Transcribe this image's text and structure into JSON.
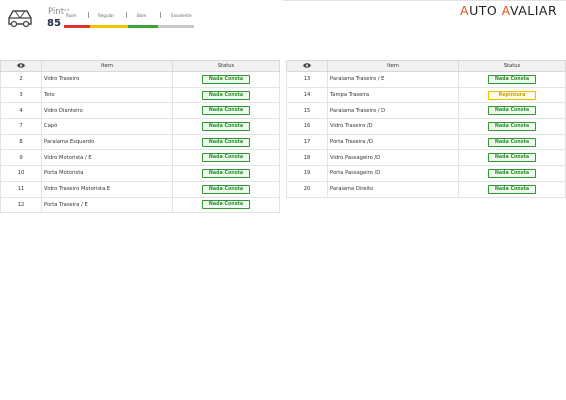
{
  "header": {
    "score_title": "Pintu",
    "score_value": "85",
    "gauge_labels": [
      "Ruim",
      "Regular",
      "Bom",
      "Excelente"
    ],
    "gauge_colors": [
      "#e03131",
      "#f2c200",
      "#3aa63a"
    ],
    "logo_part1": "AUTO",
    "logo_part2": "AVALIAR",
    "logo_accent": "#e2541d"
  },
  "table": {
    "col_item": "Item",
    "col_status": "Status"
  },
  "left_rows": [
    {
      "num": "2",
      "item": "Vidro Traseiro",
      "status": "Nada Consta",
      "type": "ok"
    },
    {
      "num": "3",
      "item": "Teto",
      "status": "Nada Consta",
      "type": "ok"
    },
    {
      "num": "4",
      "item": "Vidro Dianteiro",
      "status": "Nada Consta",
      "type": "ok"
    },
    {
      "num": "7",
      "item": "Capô",
      "status": "Nada Consta",
      "type": "ok"
    },
    {
      "num": "8",
      "item": "Paralama Esquerdo",
      "status": "Nada Consta",
      "type": "ok"
    },
    {
      "num": "9",
      "item": "Vidro Motorista / E",
      "status": "Nada Consta",
      "type": "ok"
    },
    {
      "num": "10",
      "item": "Porta Motorista",
      "status": "Nada Consta",
      "type": "ok"
    },
    {
      "num": "11",
      "item": "Vidro Traseiro Motorista E",
      "status": "Nada Consta",
      "type": "ok"
    },
    {
      "num": "12",
      "item": "Porta Traseira / E",
      "status": "Nada Consta",
      "type": "ok"
    }
  ],
  "right_rows": [
    {
      "num": "13",
      "item": "Paralama Traseiro / E",
      "status": "Nada Consta",
      "type": "ok"
    },
    {
      "num": "14",
      "item": "Tampa Traseira",
      "status": "Repintura",
      "type": "warn"
    },
    {
      "num": "15",
      "item": "Paralama Traseiro / D",
      "status": "Nada Consta",
      "type": "ok"
    },
    {
      "num": "16",
      "item": "Vidro Traseiro /D",
      "status": "Nada Consta",
      "type": "ok"
    },
    {
      "num": "17",
      "item": "Porta Traseira /D",
      "status": "Nada Consta",
      "type": "ok"
    },
    {
      "num": "18",
      "item": "Vidro Passageiro /D",
      "status": "Nada Consta",
      "type": "ok"
    },
    {
      "num": "19",
      "item": "Porta Passageiro /D",
      "status": "Nada Consta",
      "type": "ok"
    },
    {
      "num": "20",
      "item": "Paralama Direito",
      "status": "Nada Consta",
      "type": "ok"
    }
  ]
}
